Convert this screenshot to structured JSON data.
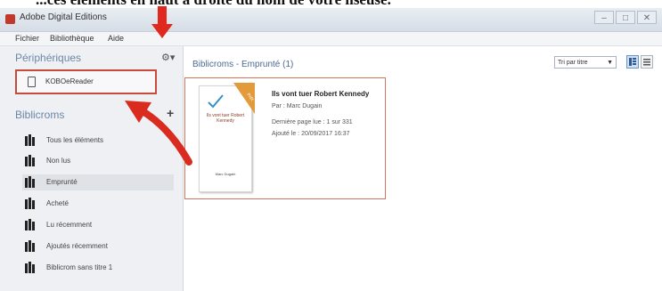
{
  "caption": "...ces éléments en haut à droite du nom de votre liseuse.",
  "window": {
    "title": "Adobe Digital Editions",
    "controls": [
      "–",
      "□",
      "✕"
    ]
  },
  "menu": [
    "Fichier",
    "Bibliothèque",
    "Aide"
  ],
  "sidebar": {
    "devices_header": "Périphériques",
    "device_name": "KOBOeReader",
    "bookshelves_header": "Biblicroms",
    "items": [
      {
        "label": "Tous les éléments"
      },
      {
        "label": "Non lus"
      },
      {
        "label": "Emprunté",
        "active": true
      },
      {
        "label": "Acheté"
      },
      {
        "label": "Lu récemment"
      },
      {
        "label": "Ajoutés récemment"
      },
      {
        "label": "Biblicrom sans titre 1"
      }
    ]
  },
  "content": {
    "header": "Biblicroms - Emprunté (1)",
    "sort_label": "Tri par titre"
  },
  "book": {
    "ribbon": "Prêt",
    "cover_title": "Ils vont tuer Robert Kennedy",
    "cover_author": "Marc Dugain",
    "title": "Ils vont tuer Robert Kennedy",
    "author_line": "Par : Marc Dugain",
    "last_page": "Dernière page lue : 1 sur 331",
    "added": "Ajouté le : 20/09/2017 16:37"
  },
  "colors": {
    "annotation_red": "#e0281e",
    "highlight_border": "#c74a3a"
  }
}
